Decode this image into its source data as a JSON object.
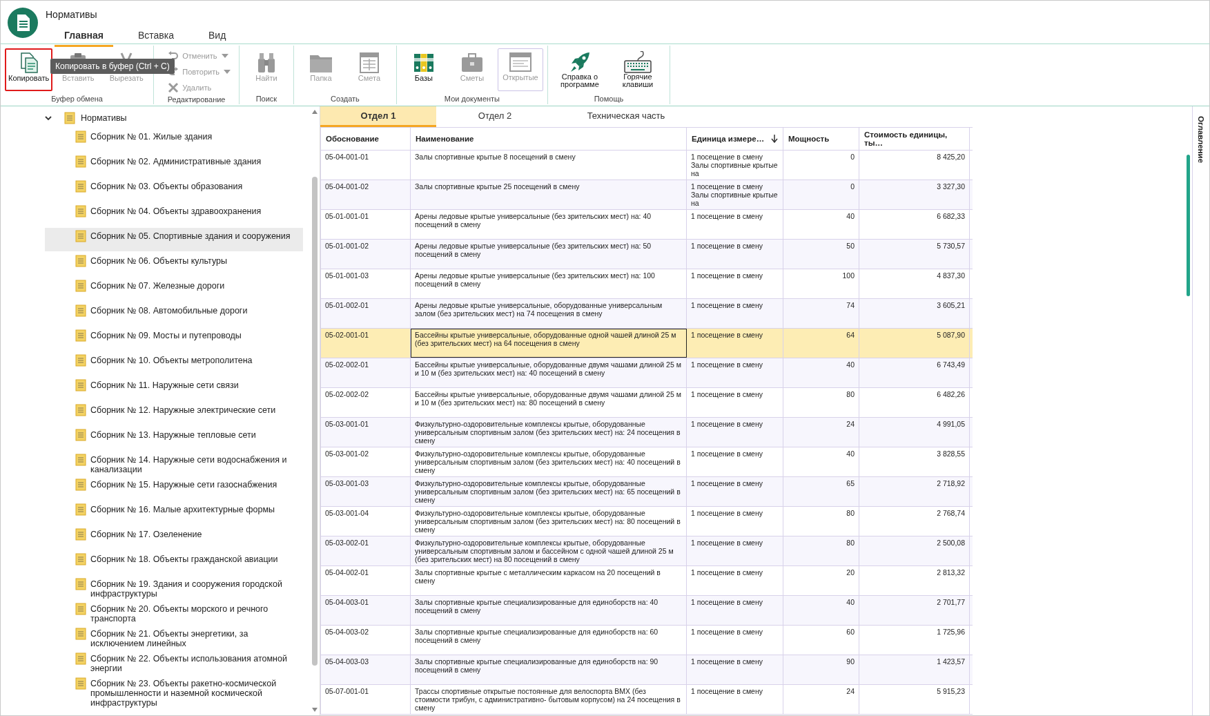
{
  "app": {
    "title": "Нормативы",
    "tabs": [
      {
        "label": "Главная",
        "selected": true
      },
      {
        "label": "Вставка",
        "selected": false
      },
      {
        "label": "Вид",
        "selected": false
      }
    ]
  },
  "ribbon": {
    "groups": [
      {
        "label": "Буфер обмена",
        "buttons": [
          {
            "label": "Копировать",
            "kind": "large",
            "disabled": false,
            "focused": true
          },
          {
            "label": "Вставить",
            "kind": "large",
            "disabled": true,
            "focused": false
          },
          {
            "label": "Вырезать",
            "kind": "large",
            "disabled": true,
            "focused": false
          }
        ]
      },
      {
        "label": "Редактирование",
        "buttons": [
          {
            "label": "Отменить",
            "kind": "small",
            "disabled": true,
            "dropdown": true
          },
          {
            "label": "Повторить",
            "kind": "small",
            "disabled": true,
            "dropdown": true
          },
          {
            "label": "Удалить",
            "kind": "small",
            "disabled": true,
            "dropdown": false
          }
        ]
      },
      {
        "label": "Поиск",
        "buttons": [
          {
            "label": "Найти",
            "kind": "large",
            "disabled": true,
            "focused": false
          }
        ]
      },
      {
        "label": "Создать",
        "buttons": [
          {
            "label": "Папка",
            "kind": "large",
            "disabled": true,
            "focused": false
          },
          {
            "label": "Смета",
            "kind": "large",
            "disabled": true,
            "focused": false
          }
        ]
      },
      {
        "label": "Мои документы",
        "buttons": [
          {
            "label": "Базы",
            "kind": "large",
            "disabled": false,
            "focused": false
          },
          {
            "label": "Сметы",
            "kind": "large",
            "disabled": true,
            "focused": false
          },
          {
            "label": "Открытые",
            "kind": "large",
            "disabled": true,
            "focused": true
          }
        ]
      },
      {
        "label": "Помощь",
        "buttons": [
          {
            "label": "Справка о программе",
            "kind": "large",
            "disabled": false,
            "focused": false
          },
          {
            "label": "Горячие клавиши",
            "kind": "large",
            "disabled": false,
            "focused": false
          }
        ]
      }
    ]
  },
  "tooltip": {
    "text": "Копировать в буфер (Ctrl + C)"
  },
  "tree": {
    "label": "Нормативы",
    "expanded": true,
    "children": [
      {
        "label": "Сборник № 01. Жилые здания",
        "selected": false
      },
      {
        "label": "Сборник № 02. Административные здания",
        "selected": false
      },
      {
        "label": "Сборник № 03. Объекты образования",
        "selected": false
      },
      {
        "label": "Сборник № 04. Объекты здравоохранения",
        "selected": false
      },
      {
        "label": "Сборник № 05. Спортивные здания и сооружения",
        "selected": true
      },
      {
        "label": "Сборник № 06. Объекты культуры",
        "selected": false
      },
      {
        "label": "Сборник № 07. Железные дороги",
        "selected": false
      },
      {
        "label": "Сборник № 08. Автомобильные дороги",
        "selected": false
      },
      {
        "label": "Сборник № 09. Мосты и путепроводы",
        "selected": false
      },
      {
        "label": "Сборник № 10. Объекты метрополитена",
        "selected": false
      },
      {
        "label": "Сборник № 11. Наружные сети связи",
        "selected": false
      },
      {
        "label": "Сборник № 12. Наружные электрические сети",
        "selected": false
      },
      {
        "label": "Сборник № 13. Наружные тепловые сети",
        "selected": false
      },
      {
        "label": "Сборник № 14. Наружные сети водоснабжения и канализации",
        "selected": false
      },
      {
        "label": "Сборник № 15. Наружные сети газоснабжения",
        "selected": false
      },
      {
        "label": "Сборник № 16. Малые архитектурные формы",
        "selected": false
      },
      {
        "label": "Сборник № 17. Озеленение",
        "selected": false
      },
      {
        "label": "Сборник № 18. Объекты гражданской авиации",
        "selected": false
      },
      {
        "label": "Сборник № 19. Здания и сооружения городской инфраструктуры",
        "selected": false
      },
      {
        "label": "Сборник № 20. Объекты морского и речного транспорта",
        "selected": false
      },
      {
        "label": "Сборник № 21. Объекты энергетики, за исключением линейных",
        "selected": false
      },
      {
        "label": "Сборник № 22. Объекты использования атомной энергии",
        "selected": false
      },
      {
        "label": "Сборник № 23. Объекты ракетно-космической промышленности и наземной космической инфраструктуры",
        "selected": false
      }
    ]
  },
  "doc_tabs": [
    {
      "label": "Отдел 1",
      "selected": true
    },
    {
      "label": "Отдел 2",
      "selected": false
    },
    {
      "label": "Техническая часть",
      "selected": false
    }
  ],
  "table": {
    "columns": [
      {
        "label": "Обоснование",
        "sorted": false
      },
      {
        "label": "Наименование",
        "sorted": false
      },
      {
        "label": "Единица измере…",
        "sorted": true
      },
      {
        "label": "Мощность",
        "sorted": false
      },
      {
        "label": "Стоимость единицы, ты…",
        "sorted": false
      }
    ],
    "rows": [
      {
        "selected": false,
        "cells": [
          "05-04-001-01",
          "Залы спортивные крытые 8 посещений в смену",
          "1 посещение в смену Залы спортивные крытые на",
          "0",
          "8 425,20"
        ]
      },
      {
        "selected": false,
        "cells": [
          "05-04-001-02",
          "Залы спортивные крытые 25 посещений в смену",
          "1 посещение в смену Залы спортивные крытые на",
          "0",
          "3 327,30"
        ]
      },
      {
        "selected": false,
        "cells": [
          "05-01-001-01",
          "Арены ледовые крытые универсальные (без зрительских мест) на: 40 посещений в смену",
          "1 посещение в смену",
          "40",
          "6 682,33"
        ]
      },
      {
        "selected": false,
        "cells": [
          "05-01-001-02",
          "Арены ледовые крытые универсальные (без зрительских мест) на: 50 посещений в смену",
          "1 посещение в смену",
          "50",
          "5 730,57"
        ]
      },
      {
        "selected": false,
        "cells": [
          "05-01-001-03",
          "Арены ледовые крытые универсальные (без зрительских мест) на: 100 посещений в смену",
          "1 посещение в смену",
          "100",
          "4 837,30"
        ]
      },
      {
        "selected": false,
        "cells": [
          "05-01-002-01",
          "Арены ледовые крытые универсальные, оборудованные универсальным залом (без зрительских мест) на 74 посещения в смену",
          "1 посещение в смену",
          "74",
          "3 605,21"
        ]
      },
      {
        "selected": true,
        "cells": [
          "05-02-001-01",
          "Бассейны крытые универсальные, оборудованные одной чашей длиной 25 м (без зрительских мест) на 64 посещения в смену",
          "1 посещение в смену",
          "64",
          "5 087,90"
        ]
      },
      {
        "selected": false,
        "cells": [
          "05-02-002-01",
          "Бассейны крытые универсальные, оборудованные двумя чашами длиной 25 м и 10 м (без зрительских мест) на: 40 посещений в смену",
          "1 посещение в смену",
          "40",
          "6 743,49"
        ]
      },
      {
        "selected": false,
        "cells": [
          "05-02-002-02",
          "Бассейны крытые универсальные, оборудованные двумя чашами длиной 25 м и 10 м (без зрительских мест) на: 80 посещений в смену",
          "1 посещение в смену",
          "80",
          "6 482,26"
        ]
      },
      {
        "selected": false,
        "cells": [
          "05-03-001-01",
          "Физкультурно-оздоровительные комплексы крытые, оборудованные универсальным спортивным залом (без зрительских мест) на: 24 посещения в смену",
          "1 посещение в смену",
          "24",
          "4 991,05"
        ]
      },
      {
        "selected": false,
        "cells": [
          "05-03-001-02",
          "Физкультурно-оздоровительные комплексы крытые, оборудованные универсальным спортивным залом (без зрительских мест) на: 40 посещений в смену",
          "1 посещение в смену",
          "40",
          "3 828,55"
        ]
      },
      {
        "selected": false,
        "cells": [
          "05-03-001-03",
          "Физкультурно-оздоровительные комплексы крытые, оборудованные универсальным спортивным залом (без зрительских мест) на: 65 посещений в смену",
          "1 посещение в смену",
          "65",
          "2 718,92"
        ]
      },
      {
        "selected": false,
        "cells": [
          "05-03-001-04",
          "Физкультурно-оздоровительные комплексы крытые, оборудованные универсальным спортивным залом (без зрительских мест) на: 80 посещений в смену",
          "1 посещение в смену",
          "80",
          "2 768,74"
        ]
      },
      {
        "selected": false,
        "cells": [
          "05-03-002-01",
          "Физкультурно-оздоровительные комплексы крытые, оборудованные универсальным спортивным залом и бассейном с одной чашей длиной 25 м (без зрительских мест) на 80 посещений в смену",
          "1 посещение в смену",
          "80",
          "2 500,08"
        ]
      },
      {
        "selected": false,
        "cells": [
          "05-04-002-01",
          "Залы спортивные крытые с металлическим каркасом на 20 посещений в смену",
          "1 посещение в смену",
          "20",
          "2 813,32"
        ]
      },
      {
        "selected": false,
        "cells": [
          "05-04-003-01",
          "Залы спортивные крытые специализированные для единоборств на: 40 посещений в смену",
          "1 посещение в смену",
          "40",
          "2 701,77"
        ]
      },
      {
        "selected": false,
        "cells": [
          "05-04-003-02",
          "Залы спортивные крытые специализированные для единоборств на: 60 посещений в смену",
          "1 посещение в смену",
          "60",
          "1 725,96"
        ]
      },
      {
        "selected": false,
        "cells": [
          "05-04-003-03",
          "Залы спортивные крытые специализированные для единоборств на: 90 посещений в смену",
          "1 посещение в смену",
          "90",
          "1 423,57"
        ]
      },
      {
        "selected": false,
        "cells": [
          "05-07-001-01",
          "Трассы спортивные открытые постоянные для велоспорта BMX (без стоимости трибун, с административно- бытовым корпусом) на 24 посещения в смену",
          "1 посещение в смену",
          "24",
          "5 915,23"
        ]
      }
    ]
  },
  "side_panel": {
    "label": "Оглавление"
  }
}
